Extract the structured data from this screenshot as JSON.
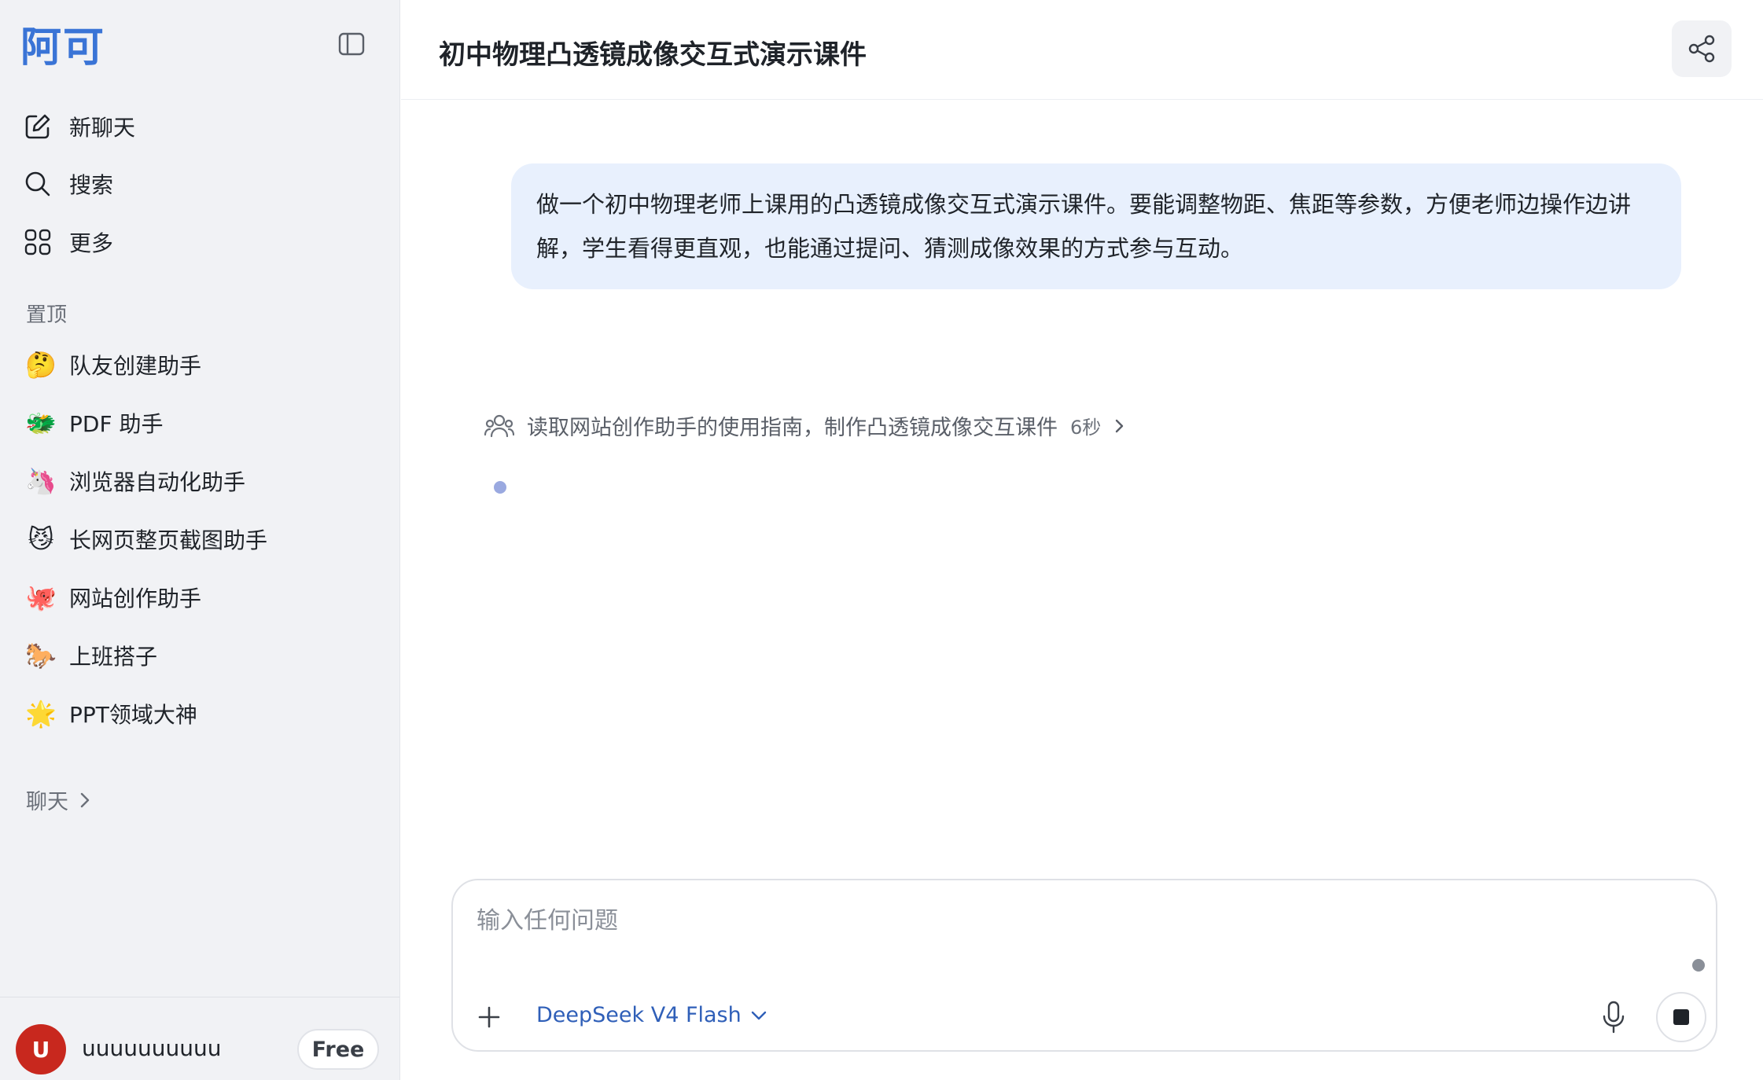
{
  "app": {
    "logo_text": "阿可"
  },
  "sidebar": {
    "nav": [
      {
        "label": "新聊天",
        "icon": "edit-icon"
      },
      {
        "label": "搜索",
        "icon": "search-icon"
      },
      {
        "label": "更多",
        "icon": "grid-icon"
      }
    ],
    "pinned_title": "置顶",
    "agents": [
      {
        "label": "队友创建助手",
        "emoji": "🤔"
      },
      {
        "label": "PDF 助手",
        "emoji": "🐲"
      },
      {
        "label": "浏览器自动化助手",
        "emoji": "🦄"
      },
      {
        "label": "长网页整页截图助手",
        "emoji": "😼"
      },
      {
        "label": "网站创作助手",
        "emoji": "🐙"
      },
      {
        "label": "上班搭子",
        "emoji": "🐎"
      },
      {
        "label": "PPT领域大神",
        "emoji": "🌟"
      }
    ],
    "chats_title": "聊天"
  },
  "user": {
    "initial": "U",
    "name": "uuuuuuuuuu",
    "plan": "Free"
  },
  "header": {
    "title": "初中物理凸透镜成像交互式演示课件"
  },
  "conversation": {
    "user_message": "做一个初中物理老师上课用的凸透镜成像交互式演示课件。要能调整物距、焦距等参数，方便老师边操作边讲解，学生看得更直观，也能通过提问、猜测成像效果的方式参与互动。",
    "step": {
      "text": "读取网站创作助手的使用指南，制作凸透镜成像交互课件",
      "time": "6秒"
    }
  },
  "composer": {
    "placeholder": "输入任何问题",
    "model": "DeepSeek V4 Flash"
  },
  "colors": {
    "accent": "#3a74d6",
    "user_bubble": "#e8f0fd",
    "avatar": "#c8281e"
  }
}
